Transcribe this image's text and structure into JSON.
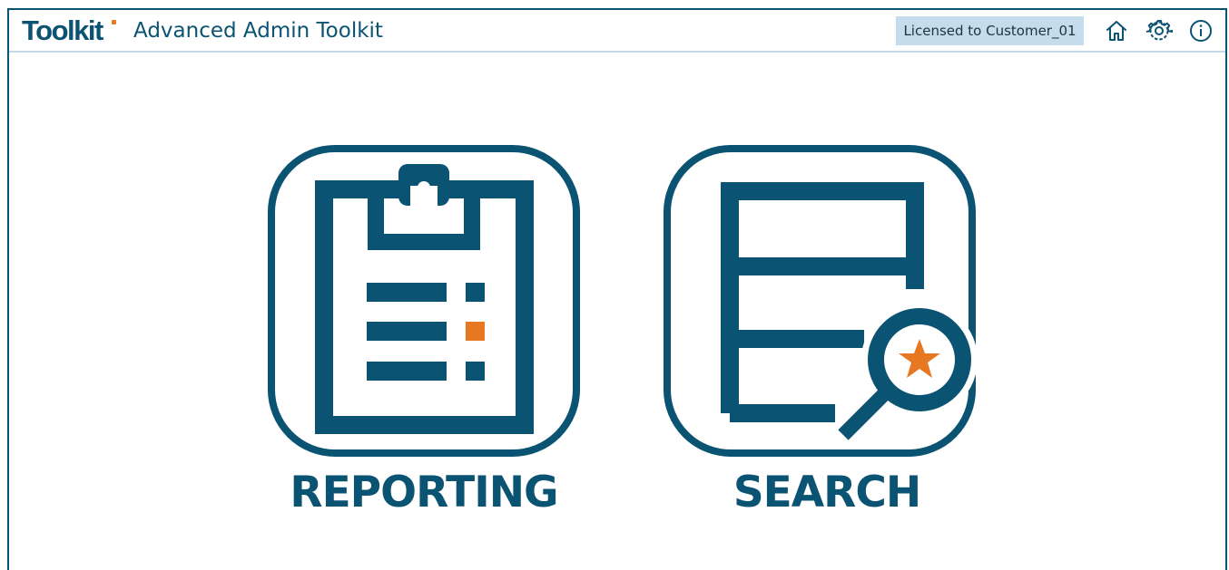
{
  "header": {
    "logo_text": "Toolkit",
    "app_title": "Advanced Admin Toolkit",
    "license_text": "Licensed to Customer_01",
    "buttons": [
      {
        "name": "home",
        "icon": "home-icon"
      },
      {
        "name": "settings",
        "icon": "gear-icon"
      },
      {
        "name": "info",
        "icon": "info-icon"
      }
    ]
  },
  "tiles": [
    {
      "label": "REPORTING",
      "icon": "clipboard-report-icon"
    },
    {
      "label": "SEARCH",
      "icon": "document-search-icon"
    }
  ],
  "colors": {
    "primary": "#0b5372",
    "accent": "#e87722",
    "license_badge_bg": "#c5dcec",
    "header_rule": "#c5d8e8"
  }
}
